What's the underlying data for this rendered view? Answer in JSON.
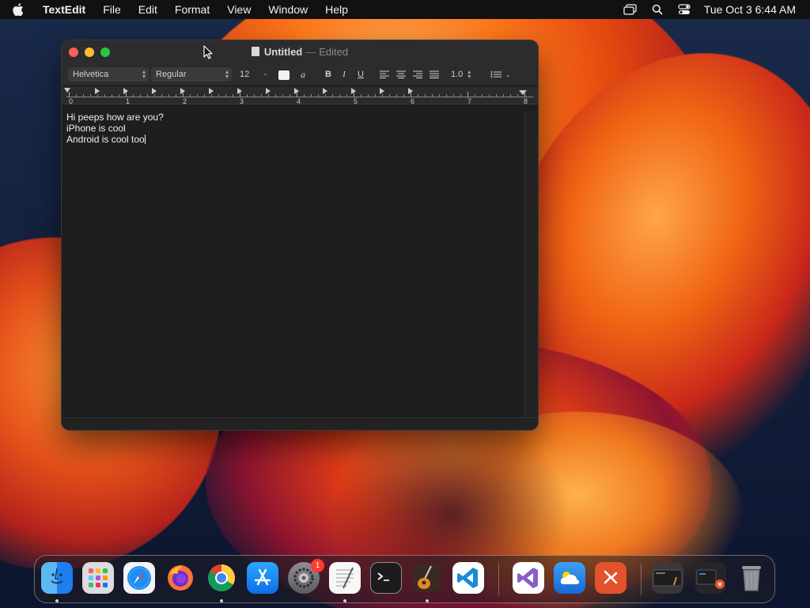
{
  "menubar": {
    "app_name": "TextEdit",
    "items": [
      "File",
      "Edit",
      "Format",
      "View",
      "Window",
      "Help"
    ],
    "clock": "Tue Oct 3  6:44 AM"
  },
  "window": {
    "title": "Untitled",
    "separator": "—",
    "status": "Edited"
  },
  "toolbar": {
    "font_family": "Helvetica",
    "font_style": "Regular",
    "font_size": "12",
    "highlight_label": "a",
    "bold_label": "B",
    "italic_label": "I",
    "underline_label": "U",
    "line_spacing": "1.0",
    "text_color": "#f2f2f2"
  },
  "ruler": {
    "numbers": [
      "0",
      "1",
      "2",
      "3",
      "4",
      "5",
      "6",
      "7",
      "8"
    ]
  },
  "document": {
    "lines": [
      "Hi peeps how are you?",
      "iPhone is cool",
      "Android is cool too"
    ]
  },
  "dock": {
    "apps": [
      "finder",
      "launchpad",
      "safari",
      "firefox",
      "chrome",
      "app-store",
      "system-settings",
      "textedit",
      "terminal",
      "garageband",
      "vscode",
      "visual-studio",
      "icloud-weather",
      "remote-desktop"
    ],
    "settings_badge": "1"
  }
}
